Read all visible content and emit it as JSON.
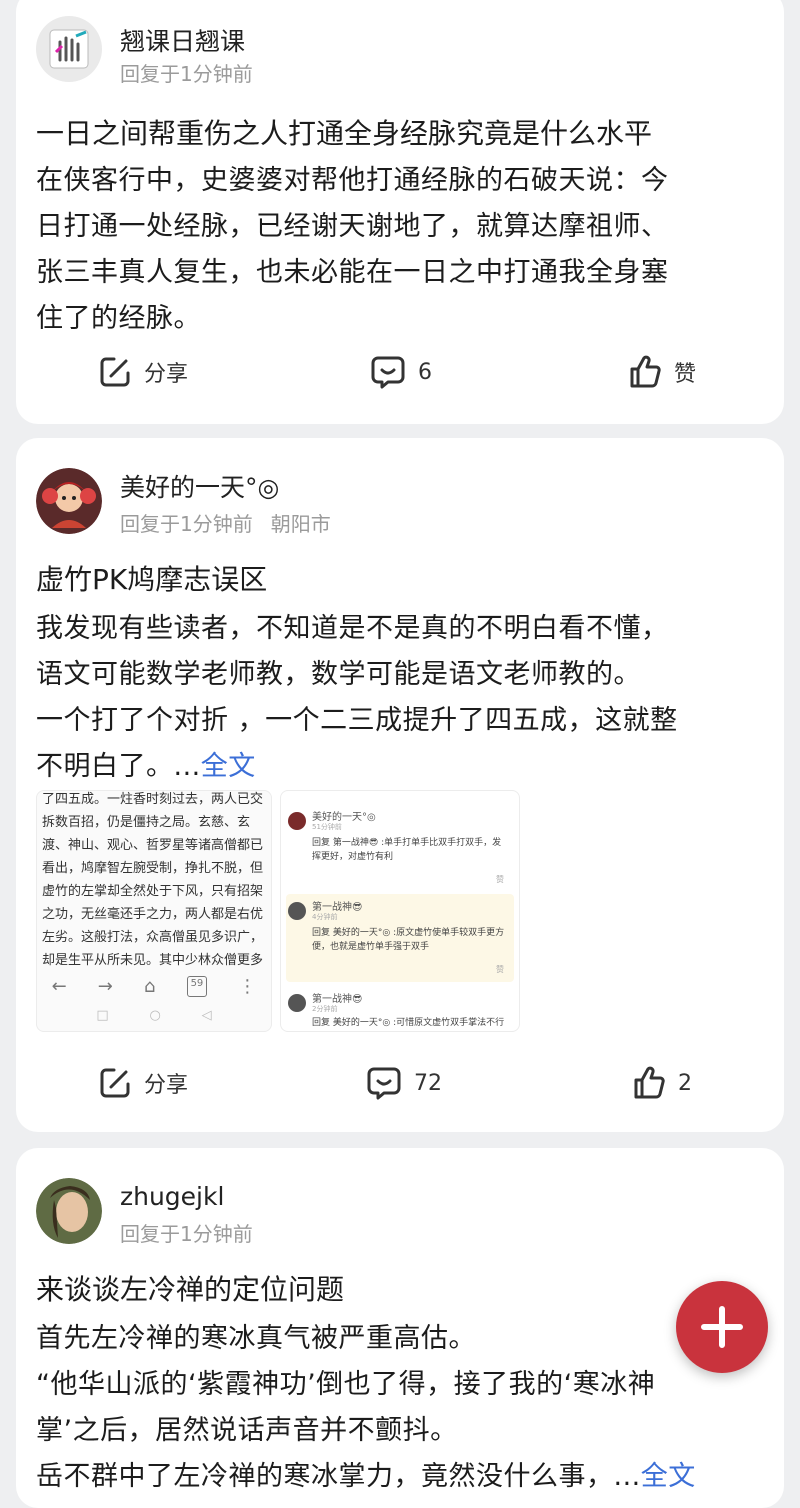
{
  "posts": [
    {
      "username": "翘课日翘课",
      "reply_time": "回复于1分钟前",
      "title": "一日之间帮重伤之人打通全身经脉究竟是什么水平",
      "lines": [
        "在侠客行中，史婆婆对帮他打通经脉的石破天说：今",
        "日打通一处经脉，已经谢天谢地了，就算达摩祖师、",
        "张三丰真人复生，也未必能在一日之中打通我全身塞",
        "住了的经脉。"
      ],
      "share_label": "分享",
      "comment_count": "6",
      "like_label": "赞"
    },
    {
      "username": "美好的一天°◎",
      "reply_time": "回复于1分钟前",
      "location": "朝阳市",
      "title": "虚竹PK鸠摩志误区",
      "lines": [
        "我发现有些读者，不知道是不是真的不明白看不懂，",
        "语文可能数学老师教，数学可能是语文老师教的。",
        "一个打了个对折 ，一个二三成提升了四五成，这就整"
      ],
      "last_line": "不明白了。...",
      "more_label": "全文",
      "share_label": "分享",
      "comment_count": "72",
      "like_count": "2",
      "image1": {
        "lines": [
          "了四五成。一炷香时刻过去，两人已交",
          "拆数百招，仍是僵持之局。玄慈、玄",
          "渡、神山、观心、哲罗星等诸高僧都已",
          "看出，鸠摩智左腕受制，挣扎不脱，但",
          "虚竹的左掌却全然处于下风，只有招架",
          "之功，无丝毫还手之力，两人都是右优",
          "左劣。这般打法，众高僧虽见多识广，",
          "却是生平从所未见。其中少林众僧更多"
        ],
        "nav": [
          "←",
          "→",
          "⌂",
          "59",
          "⋮"
        ],
        "sys": [
          "□",
          "○",
          "◁"
        ]
      },
      "image2": {
        "comments": [
          {
            "name": "美好的一天°◎",
            "time": "51分钟前",
            "body": "回复 第一战神😎 :单手打单手比双手打双手，发挥更好，对虚竹有利",
            "act": "赞"
          },
          {
            "name": "第一战神😎",
            "time": "4分钟前",
            "body": "回复 美好的一天°◎ :原文虚竹使单手较双手更方便，也就是虚竹单手强于双手",
            "act": "赞"
          },
          {
            "name": "第一战神😎",
            "time": "2分钟前",
            "body": "回复 美好的一天°◎ :可惜原文虚竹双手掌法不行",
            "act": ""
          }
        ]
      }
    },
    {
      "username": "zhugejkl",
      "reply_time": "回复于1分钟前",
      "title": "来谈谈左冷禅的定位问题",
      "lines": [
        "首先左冷禅的寒冰真气被严重高估。",
        "“他华山派的‘紫霞神功’倒也了得，接了我的‘寒冰神",
        "掌’之后，居然说话声音并不颤抖。"
      ],
      "last_line": "岳不群中了左冷禅的寒冰掌力，竟然没什么事，...",
      "more_label": "全文"
    }
  ],
  "fab": {
    "icon": "plus-icon"
  },
  "colors": {
    "accent_link": "#3c6fd7",
    "fab": "#c9333d",
    "background": "#eeeff1"
  }
}
